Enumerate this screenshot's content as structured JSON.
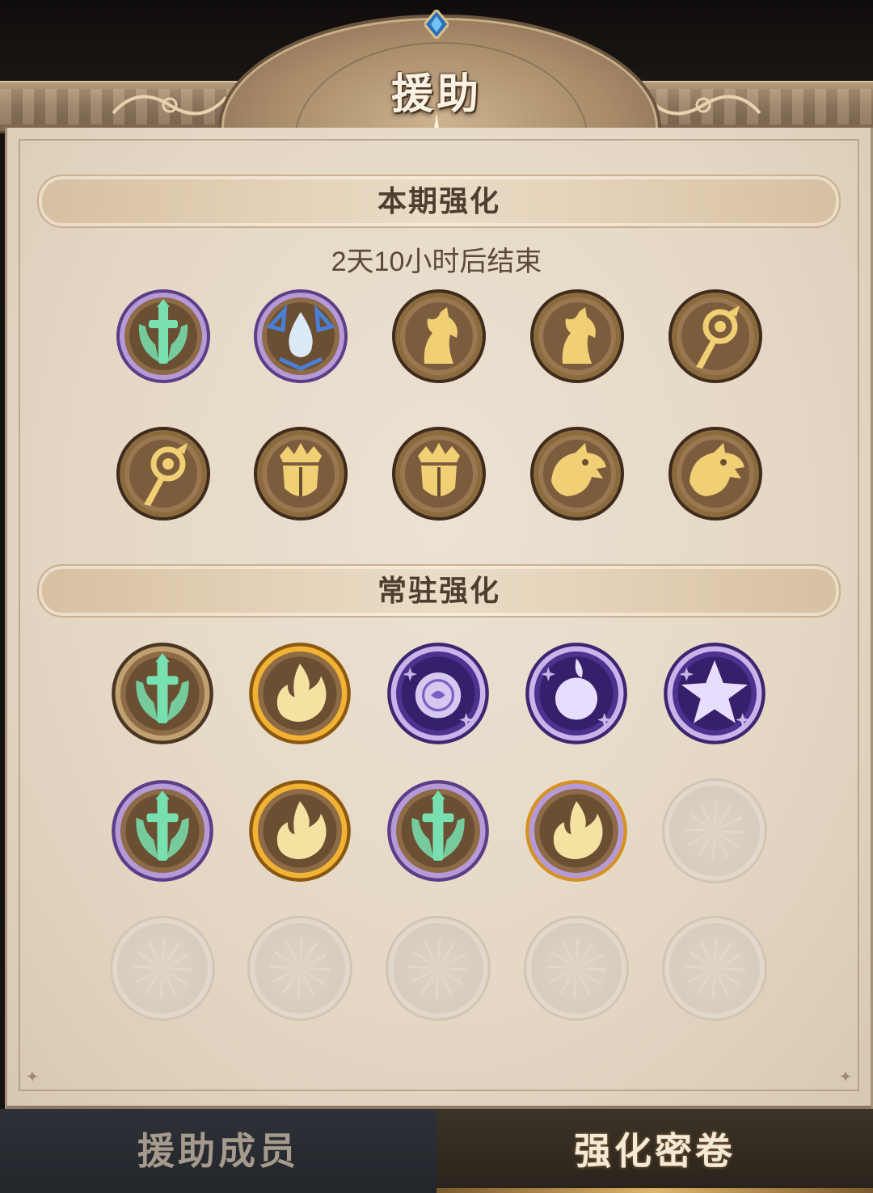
{
  "header": {
    "title": "援助"
  },
  "current_section": {
    "title": "本期强化",
    "timer": "2天10小时后结束",
    "emblems": [
      {
        "icon": "sword-wings-icon",
        "style": "green-purple"
      },
      {
        "icon": "water-drop-claws-icon",
        "style": "blue-purple"
      },
      {
        "icon": "horse-head-icon",
        "style": "gold"
      },
      {
        "icon": "horse-head-icon",
        "style": "gold"
      },
      {
        "icon": "dragon-staff-icon",
        "style": "gold"
      },
      {
        "icon": "dragon-staff-icon",
        "style": "gold"
      },
      {
        "icon": "crown-shield-icon",
        "style": "gold"
      },
      {
        "icon": "crown-shield-icon",
        "style": "gold"
      },
      {
        "icon": "dragon-head-icon",
        "style": "gold"
      },
      {
        "icon": "dragon-head-icon",
        "style": "gold"
      }
    ]
  },
  "permanent_section": {
    "title": "常驻强化",
    "emblems": [
      {
        "icon": "sword-wings-icon",
        "style": "green-bronze"
      },
      {
        "icon": "flame-icon",
        "style": "orange"
      },
      {
        "icon": "spirit-orb-icon",
        "style": "purple"
      },
      {
        "icon": "purple-flame-orb-icon",
        "style": "purple"
      },
      {
        "icon": "star-icon",
        "style": "purple"
      },
      {
        "icon": "sword-wings-icon",
        "style": "green-purple"
      },
      {
        "icon": "flame-icon",
        "style": "orange"
      },
      {
        "icon": "sword-wings-icon",
        "style": "green-purple"
      },
      {
        "icon": "flame-icon",
        "style": "orange-purple"
      },
      {
        "icon": "empty-slot",
        "style": "empty"
      },
      {
        "icon": "empty-slot",
        "style": "empty"
      },
      {
        "icon": "empty-slot",
        "style": "empty"
      },
      {
        "icon": "empty-slot",
        "style": "empty"
      },
      {
        "icon": "empty-slot",
        "style": "empty"
      },
      {
        "icon": "empty-slot",
        "style": "empty"
      }
    ]
  },
  "tabs": [
    {
      "label": "援助成员",
      "active": false
    },
    {
      "label": "强化密卷",
      "active": true
    }
  ],
  "colors": {
    "parchment": "#e6dac9",
    "frame": "#9c8267",
    "gold": "#e9c56b",
    "green": "#5fd3a0",
    "purple": "#5b3f9a",
    "tab_inactive": "#2a2d32",
    "tab_active": "#3a3025"
  }
}
